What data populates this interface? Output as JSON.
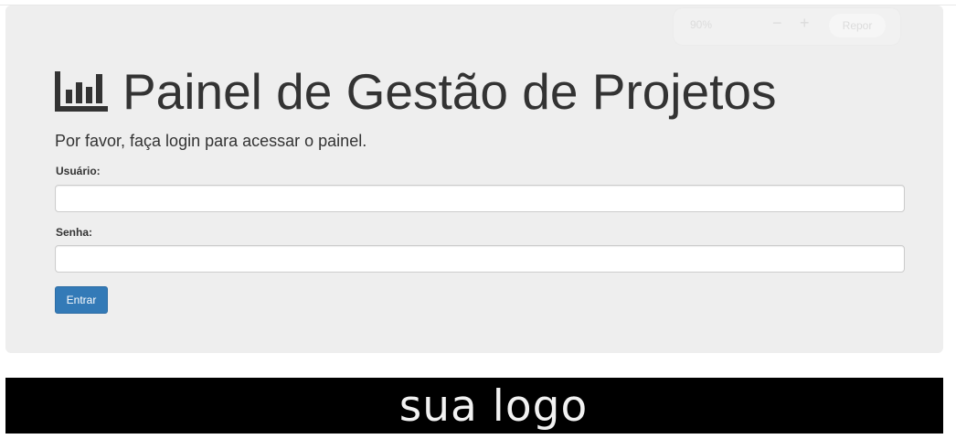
{
  "zoom": {
    "level": "90%",
    "minus": "−",
    "plus": "+",
    "reset": "Repor"
  },
  "header": {
    "title": "Painel de Gestão de Projetos",
    "icon": "bar-chart-icon",
    "subtitle": "Por favor, faça login para acessar o painel."
  },
  "form": {
    "username_label": "Usuário:",
    "username_value": "",
    "password_label": "Senha:",
    "password_value": "",
    "submit_label": "Entrar"
  },
  "footer": {
    "logo_text": "sua logo"
  },
  "colors": {
    "primary_button": "#337ab7",
    "panel_bg": "#eeeeee",
    "logo_bg": "#000000"
  }
}
